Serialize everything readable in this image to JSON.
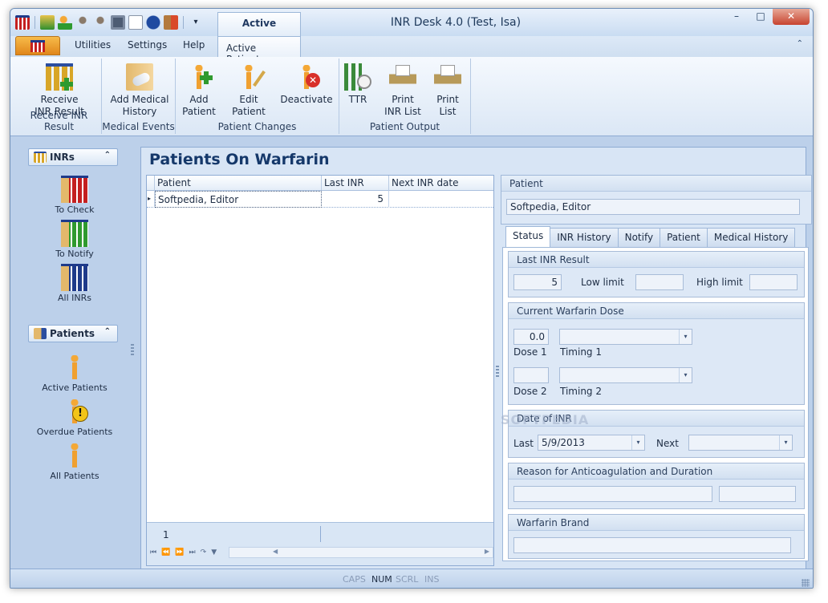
{
  "window": {
    "title": "INR Desk 4.0 (Test, Isa)",
    "context_tab": "Active Patients"
  },
  "ribbon_tabs": [
    "Utilities",
    "Settings",
    "Help",
    "Active Patients"
  ],
  "minimize_ribbon_glyph": "⌃",
  "ribbon": {
    "groups": [
      {
        "title": "Receive INR Result",
        "buttons": [
          {
            "label": "Receive\nINR Result",
            "icon": "test-tubes-plus-icon"
          }
        ]
      },
      {
        "title": "Medical Events",
        "buttons": [
          {
            "label": "Add Medical\nHistory",
            "icon": "medical-history-icon"
          }
        ]
      },
      {
        "title": "Patient Changes",
        "buttons": [
          {
            "label": "Add\nPatient",
            "icon": "add-patient-icon"
          },
          {
            "label": "Edit\nPatient",
            "icon": "edit-patient-icon"
          },
          {
            "label": "Deactivate",
            "icon": "deactivate-patient-icon"
          }
        ]
      },
      {
        "title": "Patient Output",
        "buttons": [
          {
            "label": "TTR",
            "icon": "ttr-clock-icon"
          },
          {
            "label": "Print\nINR List",
            "icon": "printer-icon"
          },
          {
            "label": "Print\nList",
            "icon": "printer-icon"
          }
        ]
      }
    ]
  },
  "nav": {
    "inrs": {
      "header": "INRs",
      "items": [
        "To Check",
        "To Notify",
        "All INRs"
      ]
    },
    "patients": {
      "header": "Patients",
      "items": [
        "Active Patients",
        "Overdue Patients",
        "All Patients"
      ]
    }
  },
  "main": {
    "title": "Patients On Warfarin",
    "grid": {
      "columns": [
        "Patient",
        "Last INR",
        "Next INR date"
      ],
      "rows": [
        {
          "patient": "Softpedia, Editor",
          "last_inr": "5",
          "next_inr_date": ""
        }
      ],
      "record_count": "1"
    }
  },
  "detail": {
    "patient_section": "Patient",
    "patient_name": "Softpedia, Editor",
    "tabs": [
      "Status",
      "INR History",
      "Notify",
      "Patient",
      "Medical History"
    ],
    "last_inr": {
      "section": "Last INR Result",
      "value": "5",
      "low_label": "Low limit",
      "high_label": "High limit"
    },
    "dose": {
      "section": "Current Warfarin Dose",
      "dose1_value": "0.0",
      "dose1_label": "Dose 1",
      "timing1_label": "Timing 1",
      "dose2_label": "Dose 2",
      "timing2_label": "Timing 2"
    },
    "date": {
      "section": "Date of INR",
      "last_label": "Last",
      "last_value": "5/9/2013",
      "next_label": "Next",
      "watermark": "SOFTPEDIA"
    },
    "reason": {
      "section": "Reason for Anticoagulation and Duration"
    },
    "brand": {
      "section": "Warfarin Brand"
    }
  },
  "statusbar": [
    "CAPS",
    "NUM",
    "SCRL",
    "INS"
  ],
  "colors": {
    "accent": "#15386a",
    "ribbon_bg": "#dbe7f5",
    "file_orange": "#e0861a"
  }
}
